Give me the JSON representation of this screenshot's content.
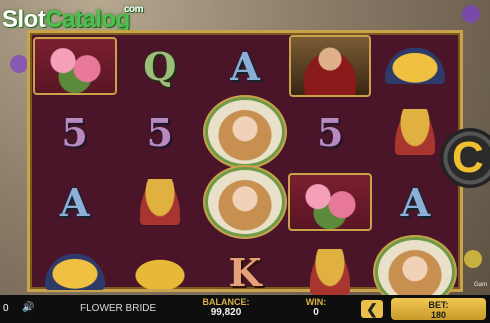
{
  "watermark": {
    "brand_part1": "Slot",
    "brand_part2": "Catalog",
    "domain": "com"
  },
  "reels": [
    [
      "roses",
      "Q",
      "A",
      "king",
      "crown"
    ],
    [
      "5",
      "5",
      "bride",
      "5",
      "goblet"
    ],
    [
      "A",
      "goblet",
      "bride",
      "roses",
      "A"
    ],
    [
      "crown",
      "tiara",
      "K",
      "goblet",
      "bride"
    ]
  ],
  "symbol_letters": {
    "Q": "Q",
    "A": "A",
    "5": "5",
    "K": "K"
  },
  "spin_button": {
    "glyph": "C"
  },
  "game_name": "FLOWER BRIDE",
  "balance": {
    "label": "BALANCE:",
    "value": "99,820"
  },
  "win": {
    "label": "WIN:",
    "value": "0"
  },
  "bet": {
    "label": "BET:",
    "value": "180",
    "decrease_glyph": "❮"
  },
  "corner_text": "Gam",
  "left_icons": {
    "info": "0",
    "speaker": "🔊"
  },
  "colors": {
    "accent_gold": "#c9a24a",
    "reel_bg": "#4a1528",
    "bet_button": "#e9c14a"
  }
}
